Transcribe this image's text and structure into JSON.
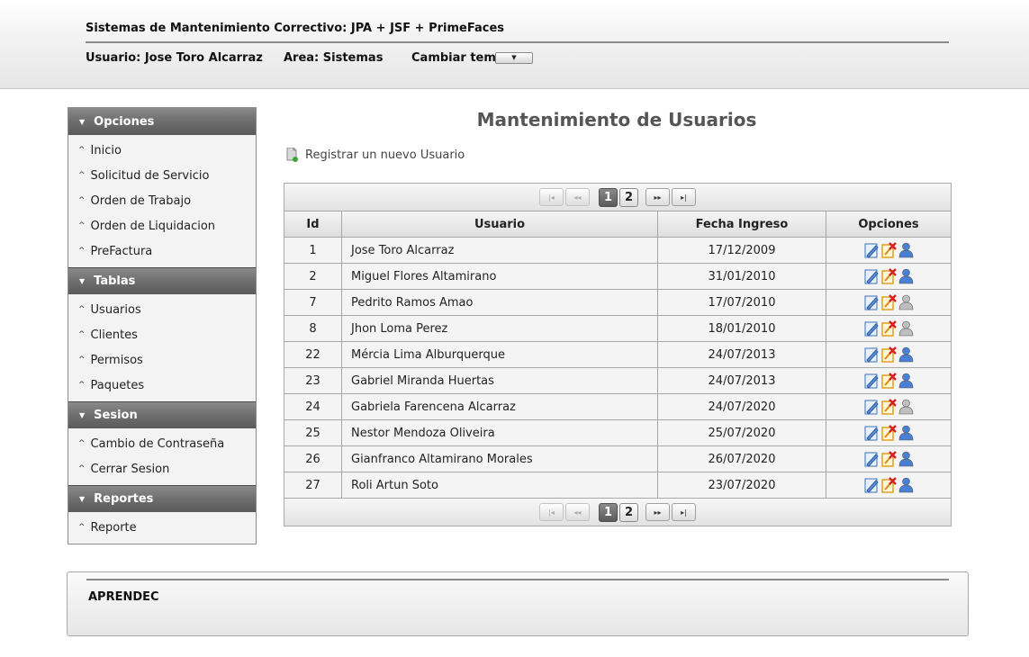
{
  "header": {
    "title": "Sistemas de Mantenimiento Correctivo: JPA + JSF + PrimeFaces",
    "user": "Usuario: Jose Toro Alcarraz",
    "area": "Area: Sistemas",
    "theme_label": "Cambiar tema:"
  },
  "sidebar": {
    "sections": [
      {
        "title": "Opciones",
        "items": [
          "Inicio",
          "Solicitud de Servicio",
          "Orden de Trabajo",
          "Orden de Liquidacion",
          "PreFactura"
        ]
      },
      {
        "title": "Tablas",
        "items": [
          "Usuarios",
          "Clientes",
          "Permisos",
          "Paquetes"
        ]
      },
      {
        "title": "Sesion",
        "items": [
          "Cambio de Contraseña",
          "Cerrar Sesion"
        ]
      },
      {
        "title": "Reportes",
        "items": [
          "Reporte"
        ]
      }
    ]
  },
  "main": {
    "title": "Mantenimiento de Usuarios",
    "register_link": "Registrar un nuevo Usuario"
  },
  "table": {
    "columns": [
      "Id",
      "Usuario",
      "Fecha Ingreso",
      "Opciones"
    ],
    "pages": [
      "1",
      "2"
    ],
    "current_page": "1",
    "rows": [
      {
        "id": "1",
        "user": "Jose Toro Alcarraz",
        "date": "17/12/2009",
        "active": true
      },
      {
        "id": "2",
        "user": "Miguel Flores Altamirano",
        "date": "31/01/2010",
        "active": true
      },
      {
        "id": "7",
        "user": "Pedrito Ramos Amao",
        "date": "17/07/2010",
        "active": false
      },
      {
        "id": "8",
        "user": "Jhon Loma Perez",
        "date": "18/01/2010",
        "active": false
      },
      {
        "id": "22",
        "user": "Mércia Lima Alburquerque",
        "date": "24/07/2013",
        "active": true
      },
      {
        "id": "23",
        "user": "Gabriel Miranda Huertas",
        "date": "24/07/2013",
        "active": true
      },
      {
        "id": "24",
        "user": "Gabriela Farencena Alcarraz",
        "date": "24/07/2020",
        "active": false
      },
      {
        "id": "25",
        "user": "Nestor Mendoza Oliveira",
        "date": "25/07/2020",
        "active": true
      },
      {
        "id": "26",
        "user": "Gianfranco Altamirano Morales",
        "date": "26/07/2020",
        "active": true
      },
      {
        "id": "27",
        "user": "Roli Artun Soto",
        "date": "23/07/2020",
        "active": true
      }
    ]
  },
  "footer": {
    "text": "APRENDEC"
  },
  "icons": {
    "edit": "edit-icon",
    "delete": "delete-icon",
    "user_active": "user-active-icon",
    "user_inactive": "user-inactive-icon",
    "register": "document-add-icon"
  },
  "colors": {
    "user_active": "#4a7fd6",
    "user_inactive": "#bfbfbf",
    "delete": "#d62020",
    "menu_header": "#6e6e6e"
  }
}
